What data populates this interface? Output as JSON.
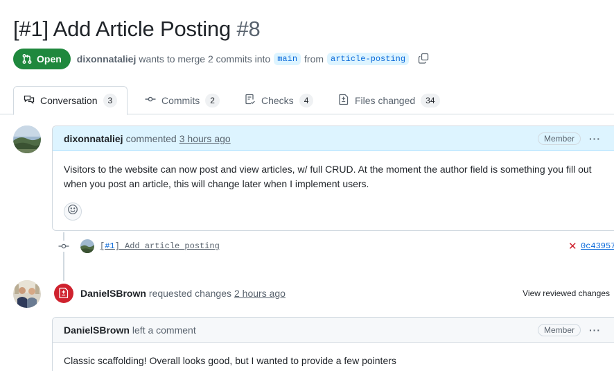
{
  "pr": {
    "title": "[#1] Add Article Posting",
    "number": "#8",
    "state": "Open",
    "author": "dixonnataliej",
    "merge_text": "wants to merge 2 commits into",
    "base_branch": "main",
    "from_text": "from",
    "head_branch": "article-posting"
  },
  "tabs": [
    {
      "label": "Conversation",
      "count": "3",
      "icon": "comment-discussion-icon"
    },
    {
      "label": "Commits",
      "count": "2",
      "icon": "git-commit-icon"
    },
    {
      "label": "Checks",
      "count": "4",
      "icon": "checklist-icon"
    },
    {
      "label": "Files changed",
      "count": "34",
      "icon": "file-diff-icon"
    }
  ],
  "comment1": {
    "author": "dixonnataliej",
    "action": "commented",
    "time": "3 hours ago",
    "role": "Member",
    "more": "···",
    "body": "Visitors to the website can now post and view articles, w/ full CRUD. At the moment the author field is something you fill out when you post an article, this will change later when I implement users."
  },
  "commit": {
    "ref": "#1",
    "message_prefix": "[",
    "message_suffix": "] Add article posting",
    "status": "✕",
    "sha": "0c43957"
  },
  "review": {
    "author": "DanielSBrown",
    "action": "requested changes",
    "time": "2 hours ago",
    "view_link": "View reviewed changes"
  },
  "comment2": {
    "author": "DanielSBrown",
    "action": "left a comment",
    "role": "Member",
    "more": "···",
    "body": "Classic scaffolding! Overall looks good, but I wanted to provide a few pointers"
  },
  "colors": {
    "open_green": "#1f883d",
    "link_blue": "#0969da",
    "branch_bg": "#ddf4ff",
    "danger_red": "#cf222e"
  }
}
